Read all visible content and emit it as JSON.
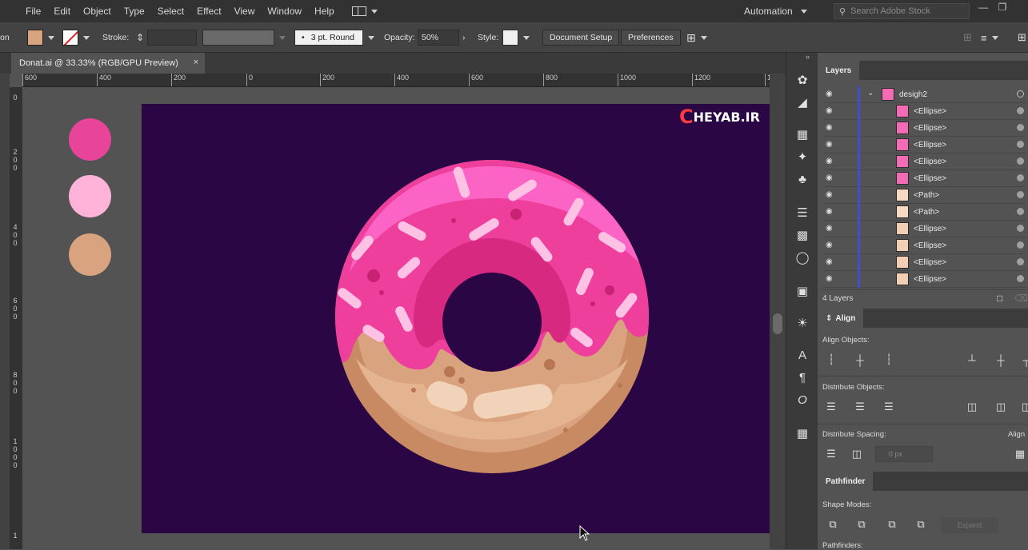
{
  "menu": [
    "File",
    "Edit",
    "Object",
    "Type",
    "Select",
    "Effect",
    "View",
    "Window",
    "Help"
  ],
  "workspace_label": "Automation",
  "search_placeholder": "Search Adobe Stock",
  "control": {
    "left_cut_label": "on",
    "stroke_label": "Stroke:",
    "brush_value": "3 pt. Round",
    "opacity_label": "Opacity:",
    "opacity_value": "50%",
    "style_label": "Style:",
    "doc_setup": "Document Setup",
    "preferences": "Preferences"
  },
  "document_tab": {
    "title": "Donat.ai @ 33.33% (RGB/GPU Preview)",
    "close": "×"
  },
  "ruler_top": [
    "600",
    "400",
    "200",
    "0",
    "200",
    "400",
    "600",
    "800",
    "1000",
    "1200",
    "1"
  ],
  "ruler_left": [
    "0",
    "2\n0\n0",
    "4\n0\n0",
    "6\n0\n0",
    "8\n0\n0",
    "1\n0\n0\n0",
    "1"
  ],
  "swatches": {
    "pink": "#e8449a",
    "light_pink": "#ffb3d9",
    "tan": "#d9a37f"
  },
  "watermark": {
    "text": "HEYAB.IR",
    "mark": "C"
  },
  "layers_panel": {
    "title": "Layers",
    "group": "desigh2",
    "items": [
      {
        "name": "<Ellipse>",
        "color": "#f46bb5"
      },
      {
        "name": "<Ellipse>",
        "color": "#f46bb5"
      },
      {
        "name": "<Ellipse>",
        "color": "#f46bb5"
      },
      {
        "name": "<Ellipse>",
        "color": "#f46bb5"
      },
      {
        "name": "<Ellipse>",
        "color": "#f46bb5"
      },
      {
        "name": "<Path>",
        "color": "#f5d9c0"
      },
      {
        "name": "<Path>",
        "color": "#f5d9c0"
      },
      {
        "name": "<Ellipse>",
        "color": "#f2cfb3"
      },
      {
        "name": "<Ellipse>",
        "color": "#f2cfb3"
      },
      {
        "name": "<Ellipse>",
        "color": "#f2cfb3"
      },
      {
        "name": "<Ellipse>",
        "color": "#f2cfb3"
      }
    ],
    "count": "4 Layers"
  },
  "align_panel": {
    "title": "Align",
    "align_objects": "Align Objects:",
    "distribute_objects": "Distribute Objects:",
    "distribute_spacing": "Distribute Spacing:",
    "align_to": "Align",
    "spacing_value": "0 px"
  },
  "pathfinder_panel": {
    "title": "Pathfinder",
    "shape_modes": "Shape Modes:",
    "expand": "Expand",
    "pathfinders": "Pathfinders:"
  }
}
